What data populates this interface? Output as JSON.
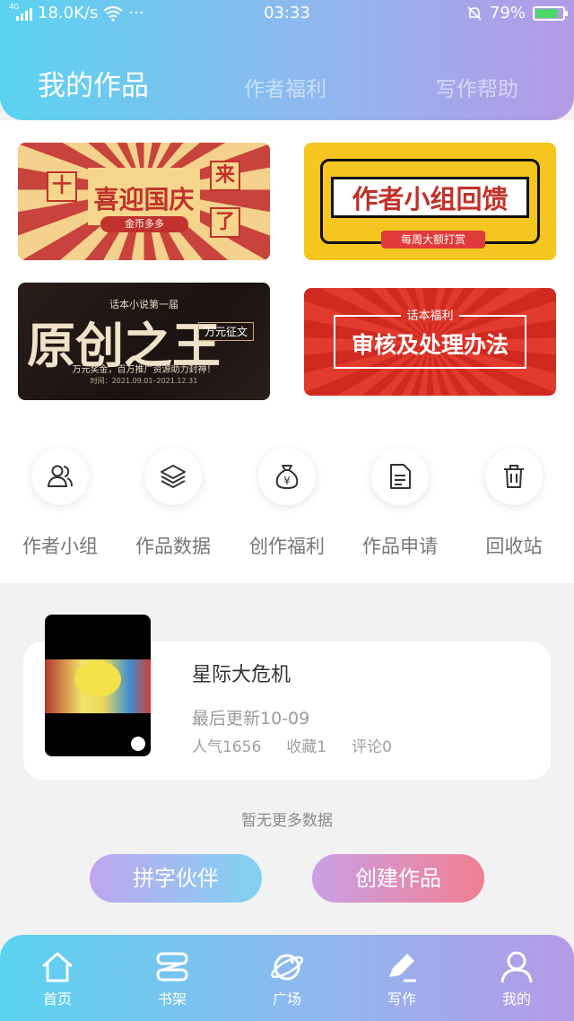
{
  "status_bar": {
    "network_speed": "18.0K/s",
    "dots": "···",
    "time": "03:33",
    "battery": "79%",
    "battery_level": 0.79,
    "signal_label": "4G"
  },
  "tabs": [
    {
      "label": "我的作品",
      "active": true
    },
    {
      "label": "作者福利",
      "active": false
    },
    {
      "label": "写作帮助",
      "active": false
    }
  ],
  "banners": {
    "national_day": {
      "left": "十",
      "right": "来",
      "right2": "了",
      "main": "喜迎国庆",
      "sub": "金币多多"
    },
    "group_feedback": {
      "main": "作者小组回馈",
      "sub": "每周大额打赏"
    },
    "original_king": {
      "top": "话本小说第一届",
      "main": "原创之王",
      "tag": "万元征文",
      "line1": "万元奖金，百万推广资源助力封神！",
      "line2": "时间：2021.09.01–2021.12.31"
    },
    "review_rules": {
      "top": "话本福利",
      "main": "审核及处理办法"
    }
  },
  "quick_actions": [
    {
      "label": "作者小组",
      "icon": "users-icon"
    },
    {
      "label": "作品数据",
      "icon": "layers-icon"
    },
    {
      "label": "创作福利",
      "icon": "money-bag-icon"
    },
    {
      "label": "作品申请",
      "icon": "document-icon"
    },
    {
      "label": "回收站",
      "icon": "trash-icon"
    }
  ],
  "work": {
    "title": "星际大危机",
    "last_update": "最后更新10-09",
    "popularity": "人气1656",
    "favorites": "收藏1",
    "comments": "评论0"
  },
  "no_more": "暂无更多数据",
  "buttons": {
    "partner": "拼字伙伴",
    "create": "创建作品"
  },
  "bottom_nav": [
    {
      "label": "首页",
      "icon": "home-icon"
    },
    {
      "label": "书架",
      "icon": "bookshelf-icon"
    },
    {
      "label": "广场",
      "icon": "planet-icon"
    },
    {
      "label": "写作",
      "icon": "pen-icon"
    },
    {
      "label": "我的",
      "icon": "profile-icon"
    }
  ],
  "colors": {
    "header_gradient_start": "#5ad3f0",
    "header_gradient_end": "#b59ae6",
    "battery_fill": "#4fd86a"
  }
}
